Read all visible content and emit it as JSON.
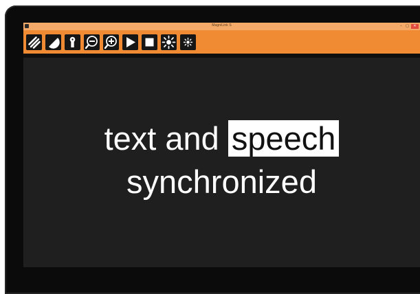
{
  "window": {
    "title": "MagniLink S",
    "controls": {
      "minimize": "–",
      "maximize": "□",
      "close": "✕"
    }
  },
  "toolbar": {
    "buttons": [
      {
        "icon": "diagonal-stripes-icon",
        "name": "contrast-stripes-button"
      },
      {
        "icon": "half-circle-icon",
        "name": "color-mode-button"
      },
      {
        "icon": "keyhole-icon",
        "name": "line-marker-button"
      },
      {
        "icon": "zoom-out-icon",
        "name": "zoom-out-button"
      },
      {
        "icon": "zoom-in-icon",
        "name": "zoom-in-button"
      },
      {
        "icon": "play-icon",
        "name": "play-button"
      },
      {
        "icon": "stop-icon",
        "name": "stop-button"
      },
      {
        "icon": "brightness-high-icon",
        "name": "brightness-up-button"
      },
      {
        "icon": "brightness-low-icon",
        "name": "brightness-down-button"
      }
    ]
  },
  "reading": {
    "line1_before": "text and ",
    "line1_highlight": "speech",
    "line2": "synchronized"
  },
  "colors": {
    "toolbar": "#f08b33",
    "reading_background": "#201f1f",
    "text": "#ffffff",
    "highlight_background": "#ffffff",
    "highlight_text": "#111111"
  }
}
